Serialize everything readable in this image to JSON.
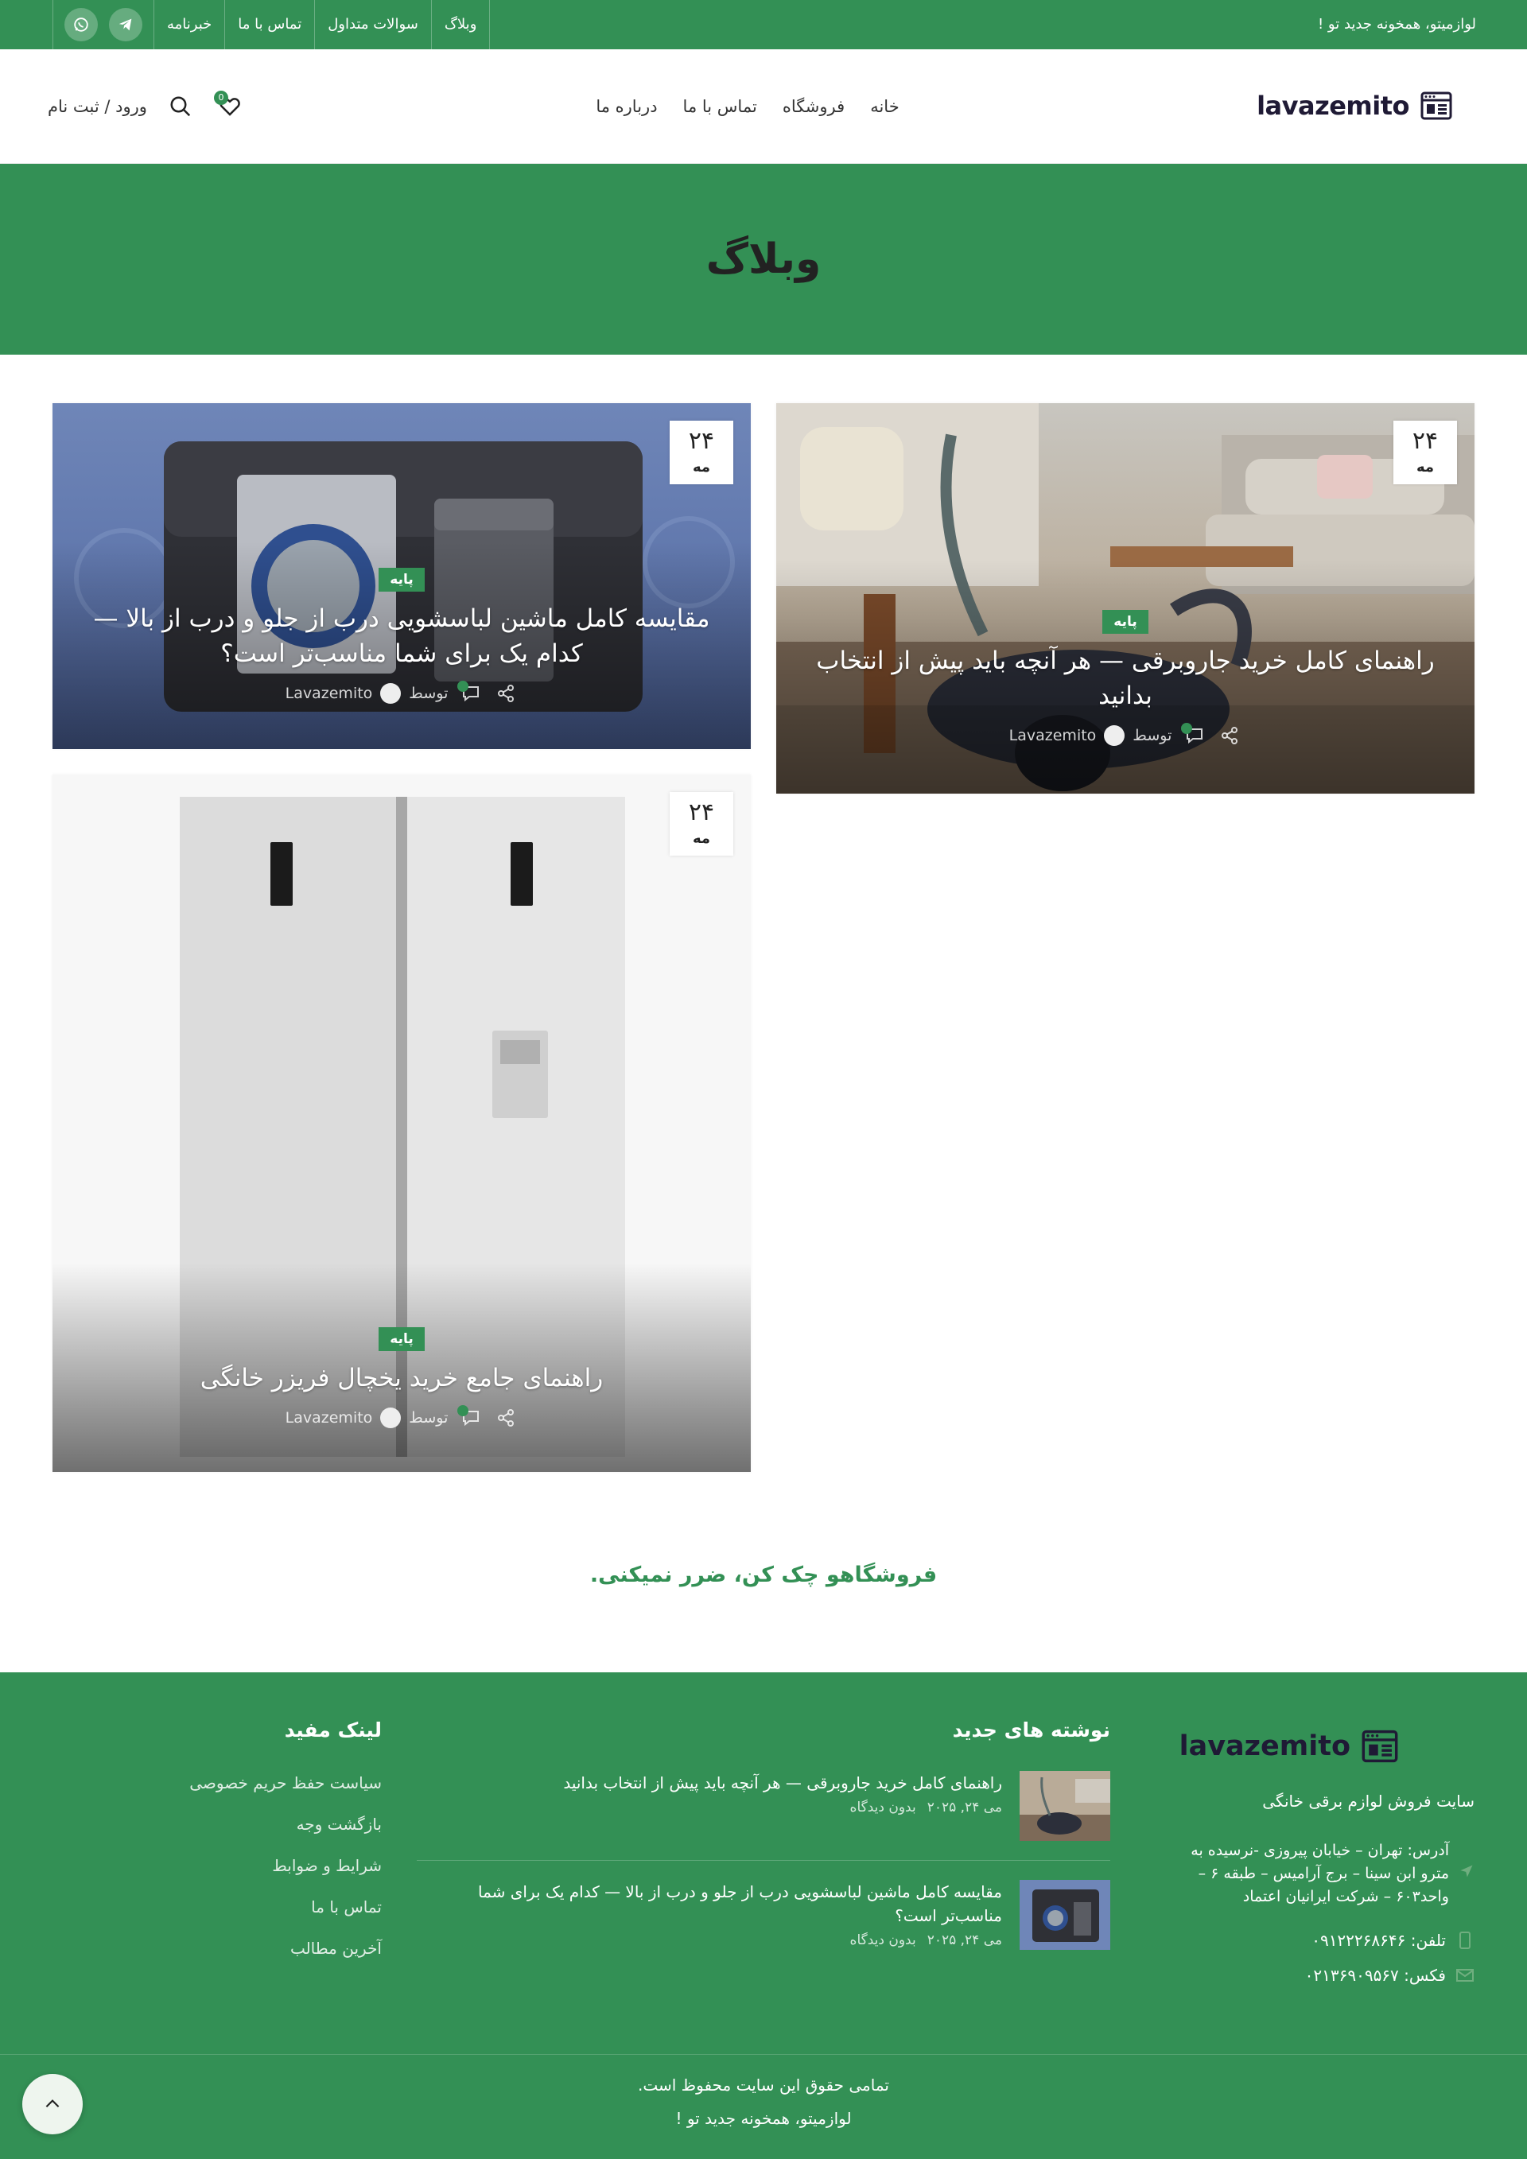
{
  "topbar": {
    "tagline": "لوازمیتو، همخونه جدید تو !",
    "links": [
      "خبرنامه",
      "تماس با ما",
      "سوالات متداول",
      "وبلاگ"
    ],
    "social": [
      "whatsapp-icon",
      "telegram-icon"
    ]
  },
  "header": {
    "logo_text": "lavazemito",
    "nav": [
      "خانه",
      "فروشگاه",
      "تماس با ما",
      "درباره ما"
    ],
    "login_label": "ورود / ثبت نام",
    "wishlist_count": "0"
  },
  "page": {
    "title": "وبلاگ"
  },
  "posts": [
    {
      "day": "۲۴",
      "month": "مه",
      "category": "پایه",
      "title": "راهنمای کامل خرید جاروبرقی — هر آنچه باید پیش از انتخاب بدانید",
      "by_label": "توسط",
      "author": "Lavazemito"
    },
    {
      "day": "۲۴",
      "month": "مه",
      "category": "پایه",
      "title": "مقایسه کامل ماشین لباسشویی درب از جلو و درب از بالا — کدام یک برای شما مناسب‌تر است؟",
      "by_label": "توسط",
      "author": "Lavazemito"
    },
    {
      "day": "۲۴",
      "month": "مه",
      "category": "پایه",
      "title": "راهنمای جامع خرید یخچال فریزر خانگی",
      "by_label": "توسط",
      "author": "Lavazemito"
    }
  ],
  "promo": "فروشگاهو چک کن، ضرر نمیکنی.",
  "footer": {
    "logo_text": "lavazemito",
    "desc": "سایت فروش لوازم برقی خانگی",
    "address": "آدرس: تهران – خیابان پیروزی -نرسیده به مترو ابن سینا – برج آرامیس – طبقه ۶ – واحد۶۰۳ – شرکت ایرانیان اعتماد",
    "phone": "تلفن: ۰۹۱۲۲۲۶۸۶۴۶",
    "fax": "فکس: ۰۲۱۳۶۹۰۹۵۶۷",
    "recent_title": "نوشته های جدید",
    "recent": [
      {
        "title": "راهنمای کامل خرید جاروبرقی — هر آنچه باید پیش از انتخاب بدانید",
        "date": "می ۲۴, ۲۰۲۵",
        "views": "بدون دیدگاه"
      },
      {
        "title": "مقایسه کامل ماشین لباسشویی درب از جلو و درب از بالا — کدام یک برای شما مناسب‌تر است؟",
        "date": "می ۲۴, ۲۰۲۵",
        "views": "بدون دیدگاه"
      }
    ],
    "links_title": "لینک مفید",
    "links": [
      "سیاست حفظ حریم خصوصی",
      "بازگشت وجه",
      "شرایط و ضوابط",
      "تماس با ما",
      "آخرین مطالب"
    ],
    "copyright": "تمامی حقوق این سایت محفوظ است.",
    "slogan": "لوازمیتو، همخونه جدید تو !"
  },
  "colors": {
    "brand_green": "#339055",
    "logo_dark": "#1f1a35"
  }
}
